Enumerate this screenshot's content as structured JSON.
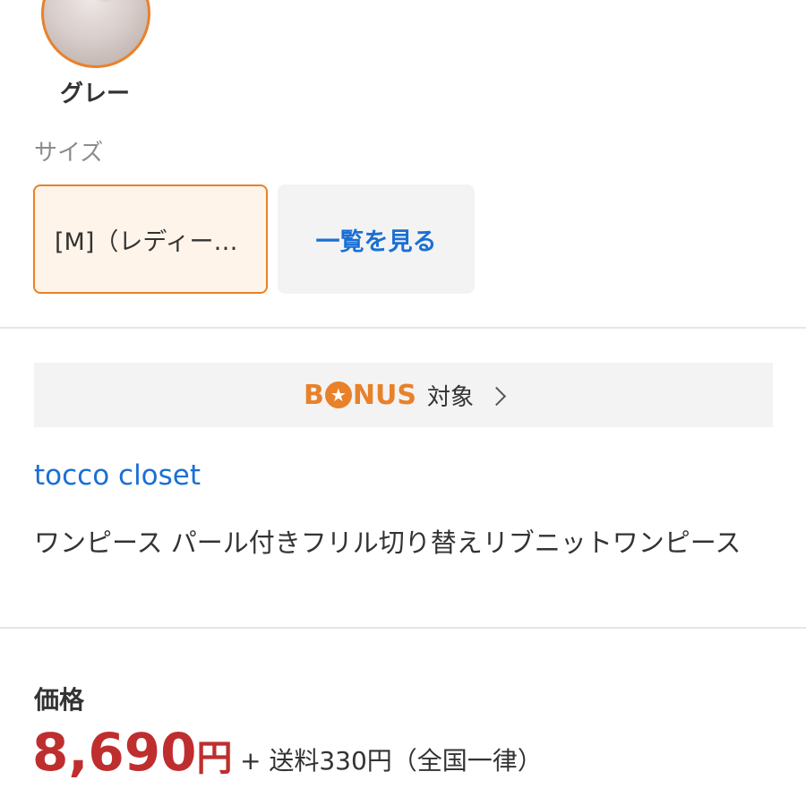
{
  "color": {
    "selected_label": "グレー",
    "swatch_icon": "gray-knit-dress-thumbnail",
    "accent_color": "#e8812a"
  },
  "size": {
    "heading": "サイズ",
    "selected_option": "[M]（レディー…",
    "view_all_label": "一覧を見る"
  },
  "bonus": {
    "logo_text_1": "B",
    "logo_star": "★",
    "logo_text_2": "NUS",
    "label": "対象",
    "chevron_icon": "chevron-right-icon"
  },
  "shop": {
    "name": "tocco closet"
  },
  "product": {
    "title": "ワンピース パール付きフリル切り替えリブニットワンピース"
  },
  "price": {
    "heading": "価格",
    "amount": "8,690",
    "unit": "円",
    "shipping": "+ 送料330円（全国一律）"
  },
  "colors": {
    "price_red": "#bf2e2e",
    "link_blue": "#1a6fd4",
    "brand_orange": "#e8812a"
  }
}
